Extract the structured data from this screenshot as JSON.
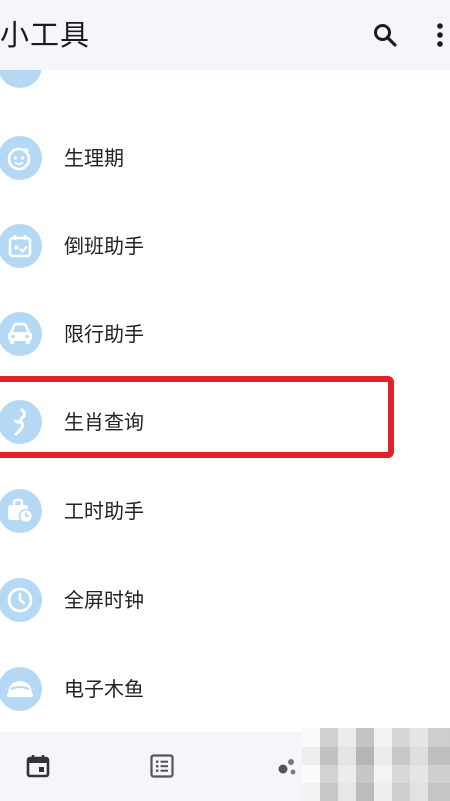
{
  "header": {
    "title": "小工具",
    "search_icon": "search-icon",
    "more_icon": "more-vert-icon"
  },
  "colors": {
    "icon_background": "#b5d9f5",
    "icon_foreground": "#ffffff",
    "header_background": "#f4f6fb",
    "highlight_border": "#e0232b"
  },
  "tools": [
    {
      "label": "生理期",
      "icon": "baby-face-icon"
    },
    {
      "label": "倒班助手",
      "icon": "calendar-check-icon"
    },
    {
      "label": "限行助手",
      "icon": "car-icon"
    },
    {
      "label": "生肖查询",
      "icon": "zodiac-icon"
    },
    {
      "label": "工时助手",
      "icon": "briefcase-clock-icon"
    },
    {
      "label": "全屏时钟",
      "icon": "clock-icon"
    },
    {
      "label": "电子木鱼",
      "icon": "wooden-fish-icon"
    }
  ],
  "highlighted_item": "生肖查询",
  "bottom_nav": [
    {
      "icon": "calendar-icon"
    },
    {
      "icon": "list-icon"
    },
    {
      "icon": "dots-icon"
    }
  ]
}
